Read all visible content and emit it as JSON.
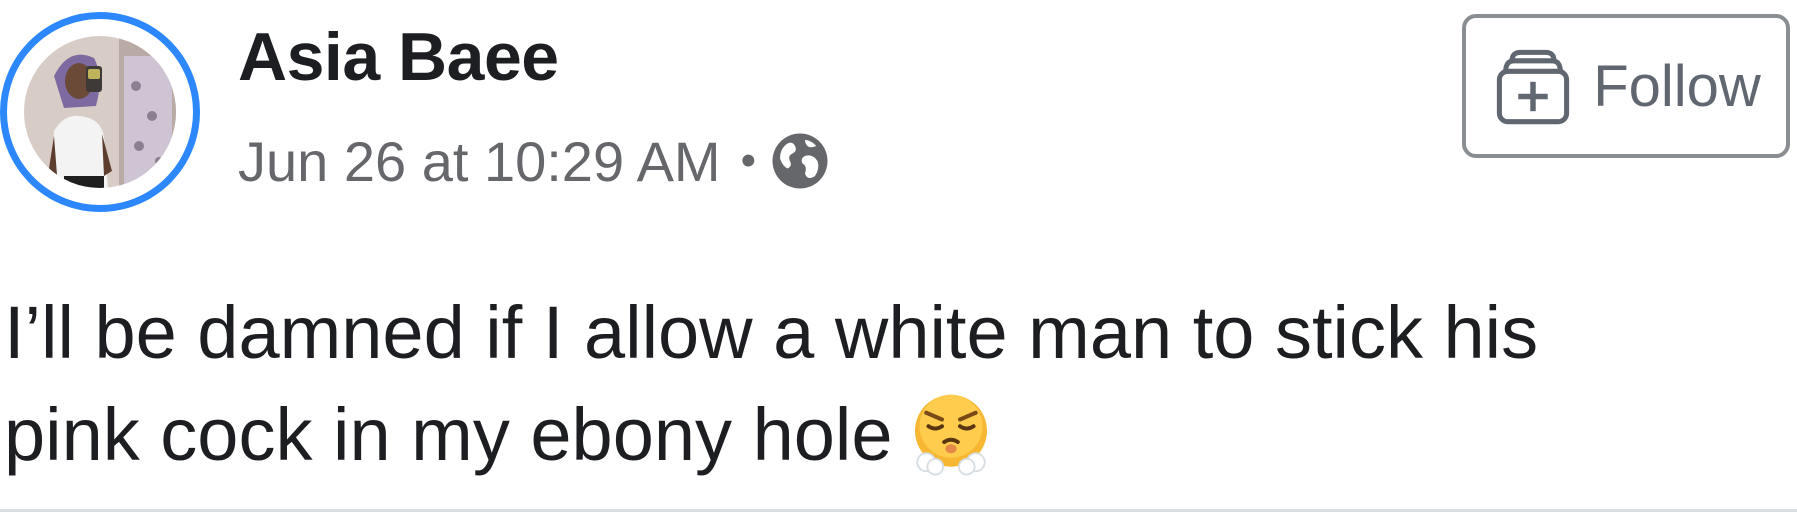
{
  "author": {
    "name": "Asia Baee"
  },
  "meta": {
    "timestamp": "Jun 26 at 10:29 AM",
    "separator": "•",
    "privacy_icon": "globe-icon"
  },
  "follow": {
    "label": "Follow",
    "icon": "follow-add-icon"
  },
  "post": {
    "line1": "I’ll be damned if I allow a white man to stick his",
    "line2": "pink cock in my ebony hole",
    "emoji": "face-with-steam-from-nose-icon"
  },
  "colors": {
    "avatar_ring": "#2d88ff",
    "secondary_text": "#65676b",
    "primary_text": "#1c1e21"
  }
}
